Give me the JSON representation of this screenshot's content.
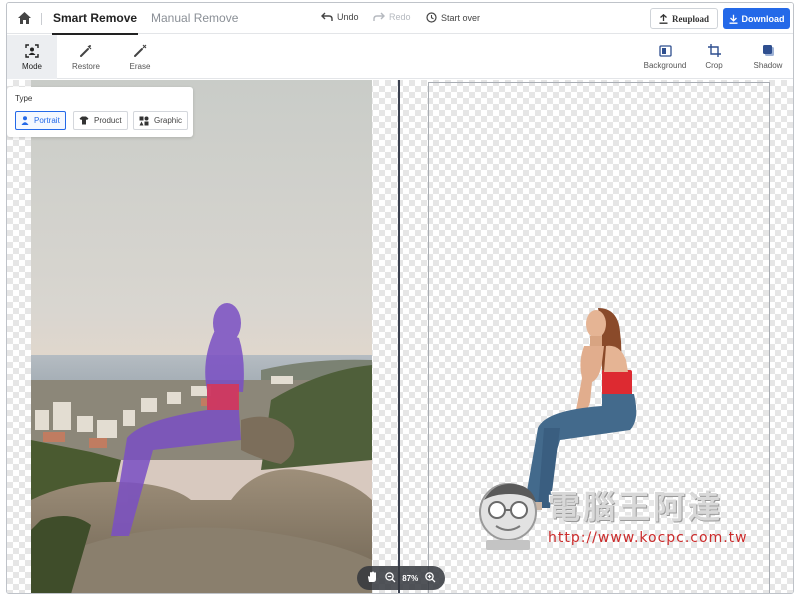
{
  "header": {
    "tabs": [
      {
        "label": "Smart Remove",
        "active": true
      },
      {
        "label": "Manual Remove",
        "active": false
      }
    ],
    "undo": "Undo",
    "redo": "Redo",
    "start_over": "Start over",
    "reupload": "Reupload",
    "download": "Download",
    "accent_color": "#2469e8"
  },
  "toolbar": {
    "left": [
      {
        "label": "Mode",
        "icon": "portrait-frame-icon",
        "active": true
      },
      {
        "label": "Restore",
        "icon": "restore-brush-icon",
        "active": false
      },
      {
        "label": "Erase",
        "icon": "erase-brush-icon",
        "active": false
      }
    ],
    "right": [
      {
        "label": "Background",
        "icon": "background-icon"
      },
      {
        "label": "Crop",
        "icon": "crop-icon"
      },
      {
        "label": "Shadow",
        "icon": "shadow-icon"
      }
    ]
  },
  "type_panel": {
    "title": "Type",
    "options": [
      {
        "label": "Portrait",
        "icon": "person-icon",
        "selected": true
      },
      {
        "label": "Product",
        "icon": "shirt-icon",
        "selected": false
      },
      {
        "label": "Graphic",
        "icon": "shapes-icon",
        "selected": false
      }
    ]
  },
  "zoom": {
    "level": "87%"
  },
  "watermark": {
    "title": "電腦王阿達",
    "url": "http://www.kocpc.com.tw"
  }
}
